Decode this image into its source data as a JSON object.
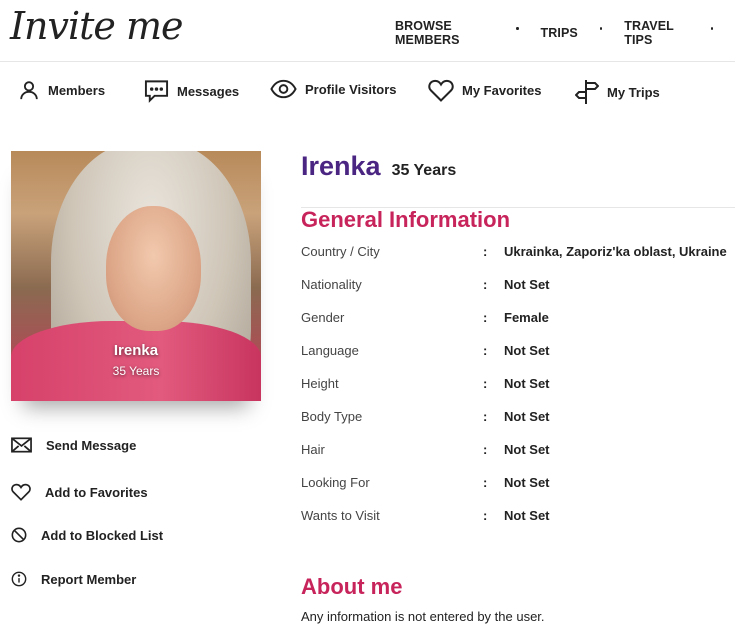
{
  "header": {
    "logo": "Invite me",
    "nav": [
      "BROWSE MEMBERS",
      "TRIPS",
      "TRAVEL TIPS"
    ]
  },
  "subnav": {
    "items": [
      {
        "label": "Members",
        "icon": "user-icon"
      },
      {
        "label": "Messages",
        "icon": "chat-icon"
      },
      {
        "label": "Profile Visitors",
        "icon": "eye-icon"
      },
      {
        "label": "My Favorites",
        "icon": "heart-icon"
      },
      {
        "label": "My Trips",
        "icon": "signpost-icon"
      }
    ]
  },
  "profile": {
    "name": "Irenka",
    "age": "35 Years",
    "photo_name": "Irenka",
    "photo_age": "35 Years"
  },
  "actions": [
    {
      "label": "Send Message",
      "icon": "envelope-icon"
    },
    {
      "label": "Add to Favorites",
      "icon": "heart-icon"
    },
    {
      "label": "Add to Blocked List",
      "icon": "block-icon"
    },
    {
      "label": "Report Member",
      "icon": "info-icon"
    }
  ],
  "general": {
    "title": "General Information",
    "separator": ":",
    "rows": [
      {
        "label": "Country / City",
        "value": "Ukrainka, Zaporiz'ka oblast, Ukraine"
      },
      {
        "label": "Nationality",
        "value": "Not Set"
      },
      {
        "label": "Gender",
        "value": "Female"
      },
      {
        "label": "Language",
        "value": "Not Set"
      },
      {
        "label": "Height",
        "value": "Not Set"
      },
      {
        "label": "Body Type",
        "value": "Not Set"
      },
      {
        "label": "Hair",
        "value": "Not Set"
      },
      {
        "label": "Looking For",
        "value": "Not Set"
      },
      {
        "label": "Wants to Visit",
        "value": "Not Set"
      }
    ]
  },
  "about": {
    "title": "About me",
    "text": "Any information is not entered by the user."
  },
  "colors": {
    "name": "#4a2582",
    "section_title": "#c8245c",
    "text": "#222222"
  }
}
